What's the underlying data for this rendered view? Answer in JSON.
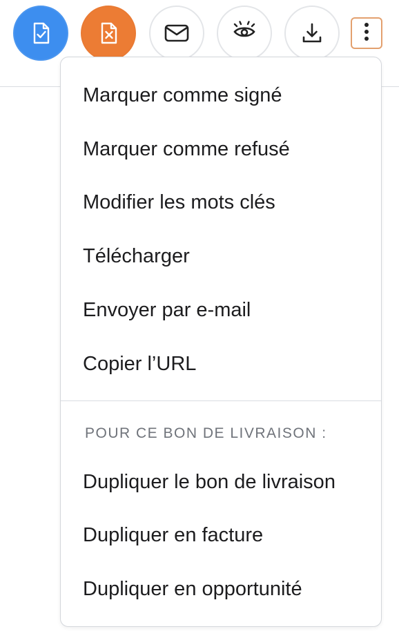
{
  "toolbar": {
    "buttons": [
      {
        "name": "mark-signed-button",
        "icon": "document-check-icon",
        "color": "#3d8eef"
      },
      {
        "name": "mark-refused-button",
        "icon": "document-x-icon",
        "color": "#ec7c34"
      },
      {
        "name": "send-email-button",
        "icon": "envelope-icon"
      },
      {
        "name": "preview-button",
        "icon": "eye-icon"
      },
      {
        "name": "download-button",
        "icon": "download-icon"
      }
    ],
    "more_icon": "vertical-dots-icon",
    "more_border_color": "#e3a06e"
  },
  "menu": {
    "items": [
      {
        "label": "Marquer comme signé"
      },
      {
        "label": "Marquer comme refusé"
      },
      {
        "label": "Modifier les mots clés"
      },
      {
        "label": "Télécharger"
      },
      {
        "label": "Envoyer par e-mail"
      },
      {
        "label": "Copier l’URL"
      }
    ],
    "section_title": "POUR CE BON DE LIVRAISON :",
    "section_items": [
      {
        "label": "Dupliquer le bon de livraison"
      },
      {
        "label": "Dupliquer en facture"
      },
      {
        "label": "Dupliquer en opportunité"
      }
    ]
  }
}
